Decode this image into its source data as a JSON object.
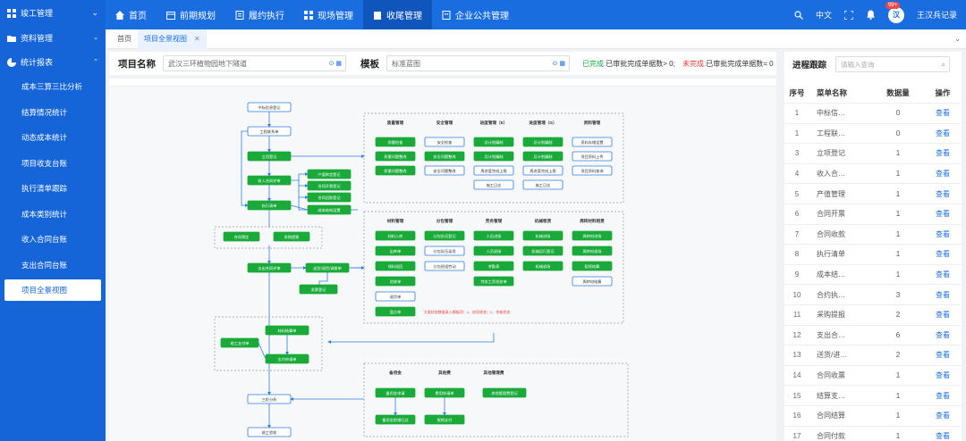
{
  "sidebar": {
    "top_item": "竣工管理",
    "groups": [
      {
        "label": "资料管理"
      },
      {
        "label": "统计报表"
      }
    ],
    "items": [
      "成本三算三比分析",
      "结算情况统计",
      "动态成本统计",
      "项目收支台账",
      "执行清单跟踪",
      "成本类别统计",
      "收入合同台账",
      "支出合同台账",
      "项目全景视图"
    ],
    "active_item": "项目全景视图"
  },
  "topbar": {
    "nav": [
      "首页",
      "前期规划",
      "履约执行",
      "现场管理",
      "收尾管理",
      "企业公共管理"
    ],
    "active_nav": "收尾管理",
    "language": "中文",
    "badge": "99+",
    "avatar_text": "汉",
    "username": "王汉兵记录"
  },
  "tabs": [
    {
      "label": "首页"
    },
    {
      "label": "项目全景视图"
    }
  ],
  "filter": {
    "project_label": "项目名称",
    "project_value": "武汉三环植物园地下隧道",
    "template_label": "模板",
    "template_value": "标准蓝图",
    "done_label": "已完成:",
    "done_text": "已审批完成单据数> 0;",
    "undone_label": "未完成:",
    "undone_text": "已审批完成单据数= 0"
  },
  "flow": {
    "main": [
      "中标信息登记",
      "工程联系单",
      "立项登记",
      "收入合同评审",
      "执行清单",
      "支出合同评审",
      "三阶分析",
      "竣工验收"
    ],
    "side1": [
      "产值审定登记",
      "合同开票登记",
      "合同回款登记",
      "成本结构设置"
    ],
    "budget": [
      "合同预定",
      "采购提报"
    ],
    "supply": [
      "送货/退货/调拨单",
      "发票登记"
    ],
    "settle": [
      "材料结算单",
      "竣工支付单",
      "支付申请单"
    ],
    "mgmt_titles": [
      "质量管理",
      "安全管理",
      "进度管理（E）",
      "进度管理（G）",
      "资料管理"
    ],
    "quality": [
      "质量检查",
      "质量问题整改",
      "质量问题整改"
    ],
    "safety": [
      "安全检查",
      "安全问题整改",
      "安全问题整改"
    ],
    "progressE": [
      "总计划编制",
      "月计划编制",
      "周进度完成上报",
      "施工日志"
    ],
    "progressG": [
      "总计划编制",
      "月计划编制",
      "周进度完成上报",
      "施工日志"
    ],
    "docs": [
      "资料存储设置",
      "项目资料上传",
      "项目资料查询"
    ],
    "cost_titles": [
      "材料管理",
      "分包管理",
      "劳务管理",
      "机械租赁",
      "周转材料租赁"
    ],
    "material": [
      "材料入库",
      "出库单",
      "领料退回",
      "验收单",
      "退货单",
      "盘点单"
    ],
    "subcon": [
      "分包队伍登记",
      "分包队伍录用",
      "分包班组劳动"
    ],
    "labor": [
      "人员进场",
      "人员退场",
      "考勤表",
      "劳务工资发放单"
    ],
    "machine": [
      "机械进场",
      "机械运行登记",
      "机械退场"
    ],
    "turnover": [
      "周转材进场",
      "周转材退场",
      "租赁结算",
      "周转材结算"
    ],
    "cost_note": "大类状态数据录入模板项：1、启用状态；2、作废状态",
    "other_titles": [
      "备用金",
      "其他费",
      "其他管理费"
    ],
    "reserve": [
      "备用金申请",
      "备用金报销归还"
    ],
    "other": [
      "费用申请单",
      "报销支付"
    ],
    "other_mgmt": [
      "其他管理费登记"
    ]
  },
  "rpanel": {
    "title": "进程跟踪",
    "search_placeholder": "请输入查询",
    "columns": [
      "序号",
      "菜单名称",
      "数据量",
      "操作"
    ],
    "rows": [
      {
        "n": "1",
        "name": "中标信…",
        "count": "0",
        "op": "查看"
      },
      {
        "n": "1",
        "name": "工程联…",
        "count": "0",
        "op": "查看"
      },
      {
        "n": "3",
        "name": "立项登记",
        "count": "1",
        "op": "查看"
      },
      {
        "n": "4",
        "name": "收入合…",
        "count": "1",
        "op": "查看"
      },
      {
        "n": "5",
        "name": "产值管理",
        "count": "1",
        "op": "查看"
      },
      {
        "n": "6",
        "name": "合同开票",
        "count": "1",
        "op": "查看"
      },
      {
        "n": "7",
        "name": "合同收款",
        "count": "1",
        "op": "查看"
      },
      {
        "n": "8",
        "name": "执行清单",
        "count": "1",
        "op": "查看"
      },
      {
        "n": "9",
        "name": "成本结…",
        "count": "1",
        "op": "查看"
      },
      {
        "n": "10",
        "name": "合约执…",
        "count": "3",
        "op": "查看"
      },
      {
        "n": "11",
        "name": "采购提报",
        "count": "2",
        "op": "查看"
      },
      {
        "n": "12",
        "name": "支出合…",
        "count": "6",
        "op": "查看"
      },
      {
        "n": "13",
        "name": "送货/进…",
        "count": "2",
        "op": "查看"
      },
      {
        "n": "14",
        "name": "合同收票",
        "count": "1",
        "op": "查看"
      },
      {
        "n": "15",
        "name": "结算支…",
        "count": "1",
        "op": "查看"
      },
      {
        "n": "16",
        "name": "合同结算",
        "count": "1",
        "op": "查看"
      },
      {
        "n": "17",
        "name": "合同付款",
        "count": "1",
        "op": "查看"
      }
    ]
  }
}
